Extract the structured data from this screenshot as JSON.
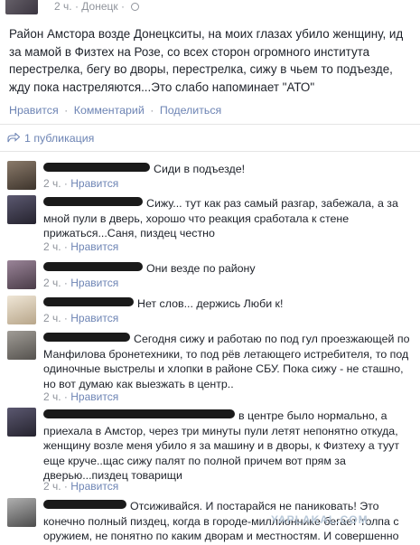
{
  "post": {
    "time": "2 ч.",
    "separator": "·",
    "location": "Донецк",
    "separator2": "·",
    "text": "Район Амстора возде Донецкситы, на моих глазах убило женщину, ид\nза мамой в Физтех на Розе, со всех сторон огромного института\nперестрелка, бегу во дворы, перестрелка, сижу в чьем то подъезде,\nжду пока настреляются...Это слабо напоминает \"АТО\"",
    "actions": [
      "Нравится",
      "Комментарий",
      "Поделиться"
    ],
    "action_separator": "·"
  },
  "shares": {
    "label": "1 публикация",
    "icon": "share-icon"
  },
  "comments": [
    {
      "text": "Сиди в подъезде!",
      "time": "2 ч.",
      "like": "Нравится",
      "avatar_color": "#5a4e45"
    },
    {
      "text": "Сижу... тут как раз самый разгар, забежала, а за мной пули в дверь, хорошо что реакция сработала к стене прижаться...Саня, пиздец честно",
      "time": "2 ч.",
      "like": "Нравится",
      "avatar_color": "#3a3a46"
    },
    {
      "text": "Они везде по району",
      "time": "2 ч.",
      "like": "Нравится",
      "avatar_color": "#6a5868"
    },
    {
      "text": "Нет слов... держись Люби к!",
      "time": "2 ч.",
      "like": "Нравится",
      "avatar_color": "#c9bba6"
    },
    {
      "text": "Сегодня сижу и работаю по под гул проезжающей по Манфилова бронетехники, то под рёв летающего истребителя, то под одиночные выстрелы и хлопки в районе СБУ. Пока сижу - не сташно, но вот думаю как выезжать в центр..",
      "time": "2 ч.",
      "like": "Нравится",
      "avatar_color": "#7d7a76"
    },
    {
      "text": "в центре было нормально, а приехала в Амстор, через три минуты пули летят непонятно откуда, женщину возле меня убило я за машину и в дворы, к Физтеху а туут еще круче..щас сижу палят по полной причем вот прям за дверью...пиздец товарищи",
      "time": "2 ч.",
      "like": "Нравится",
      "avatar_color": "#3a3a46"
    },
    {
      "text": "Отсиживайся. И постарайся не паниковать! Это конечно полный пиздец, когда в городе-миллионнике бегает толпа с оружием, не понятно по каким дворам и местностям. И совершенно",
      "time": "",
      "like": "",
      "avatar_color": "#8a8a8a"
    }
  ],
  "watermark": "YAPLAKAL.COM"
}
